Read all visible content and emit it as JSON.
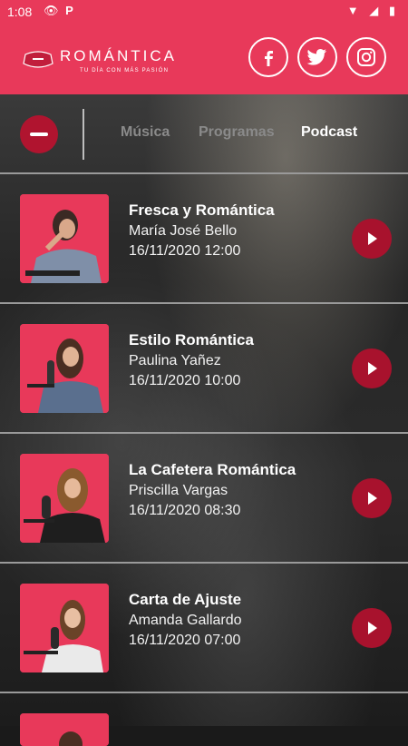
{
  "status_bar": {
    "time": "1:08",
    "left_icons": [
      "eye-icon",
      "p-icon"
    ],
    "right_icons": [
      "wifi-icon",
      "signal-icon",
      "battery-icon"
    ]
  },
  "header": {
    "logo_title": "ROMÁNTICA",
    "logo_tagline": "TU DÍA CON MÁS PASIÓN",
    "accent_color": "#e8395a",
    "social": [
      "facebook-icon",
      "twitter-icon",
      "instagram-icon"
    ]
  },
  "tabs": {
    "items": [
      {
        "label": "Música",
        "active": false
      },
      {
        "label": "Programas",
        "active": false
      },
      {
        "label": "Podcast",
        "active": true
      }
    ]
  },
  "podcasts": [
    {
      "title": "Fresca y Romántica",
      "host": "María José Bello",
      "date": "16/11/2020 12:00"
    },
    {
      "title": "Estilo Romántica",
      "host": "Paulina Yañez",
      "date": "16/11/2020 10:00"
    },
    {
      "title": "La Cafetera Romántica",
      "host": "Priscilla Vargas",
      "date": "16/11/2020 08:30"
    },
    {
      "title": "Carta de Ajuste",
      "host": "Amanda Gallardo",
      "date": "16/11/2020 07:00"
    }
  ],
  "colors": {
    "play_button": "#a8122d",
    "minus_button": "#b0142f"
  }
}
